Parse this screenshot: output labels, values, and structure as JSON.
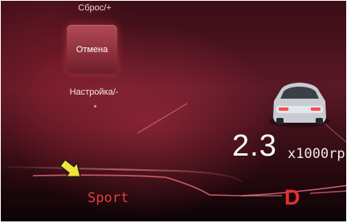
{
  "menu": {
    "reset_label": "Сброс/+",
    "cancel_label": "Отмена",
    "settings_label": "Настройка/-"
  },
  "gauge": {
    "speed_value": "2.3",
    "speed_unit": "x1000rp"
  },
  "drive": {
    "mode": "Sport",
    "gear": "D"
  },
  "colors": {
    "accent_red": "#e3312e",
    "background_dark": "#2a0a10",
    "button_fill": "#9c3a45",
    "highlight_arrow": "#f2e33a"
  },
  "icons": [
    "car-icon",
    "pointer-arrow-icon"
  ]
}
